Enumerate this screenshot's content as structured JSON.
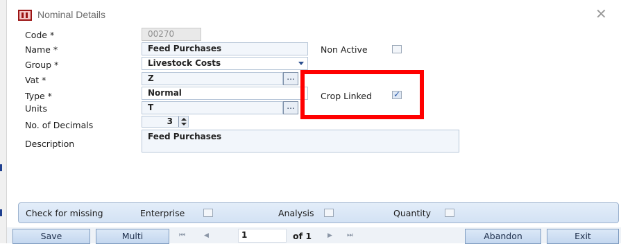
{
  "window": {
    "title": "Nominal Details",
    "close_glyph": "✕"
  },
  "form": {
    "code": {
      "label": "Code *",
      "value": "00270"
    },
    "name": {
      "label": "Name *",
      "value": "Feed Purchases"
    },
    "non_active": {
      "label": "Non Active",
      "checked": false
    },
    "group": {
      "label": "Group *",
      "value": "Livestock Costs"
    },
    "vat": {
      "label": "Vat *",
      "value": "Z",
      "button": "..."
    },
    "type": {
      "label": "Type *",
      "value": "Normal"
    },
    "crop_linked": {
      "label": "Crop Linked",
      "checked": true
    },
    "units": {
      "label": "Units",
      "value": "T",
      "button": "..."
    },
    "decimals": {
      "label": "No. of Decimals",
      "value": "3"
    },
    "description": {
      "label": "Description",
      "value": "Feed Purchases"
    }
  },
  "check_missing": {
    "label": "Check for missing",
    "enterprise": {
      "label": "Enterprise",
      "checked": false
    },
    "analysis": {
      "label": "Analysis",
      "checked": false
    },
    "quantity": {
      "label": "Quantity",
      "checked": false
    }
  },
  "toolbar": {
    "save_label": "Save",
    "multi_label": "Multi",
    "first_glyph": "⏮",
    "prev_glyph": "◀",
    "page": "1",
    "of_label": "of 1",
    "next_glyph": "▶",
    "last_glyph": "⏭",
    "abandon_label": "Abandon",
    "exit_label": "Exit"
  },
  "colors": {
    "highlight": "#ff0000",
    "accent": "#2b4f8f",
    "panel": "#d3e2f4"
  }
}
